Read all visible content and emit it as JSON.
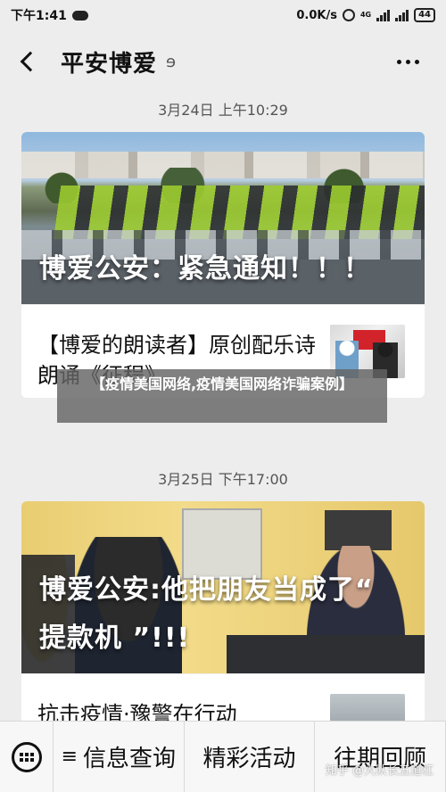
{
  "status_bar": {
    "time": "下午1:41",
    "network_speed": "0.0K/s",
    "signal_label": "4G",
    "battery": "44"
  },
  "header": {
    "title": "平安博爱"
  },
  "feed": [
    {
      "timestamp": "3月24日 上午10:29",
      "main_title": "博爱公安：紧急通知！！！",
      "sub_title": "【博爱的朗读者】原创配乐诗朗诵《征程》…"
    },
    {
      "timestamp": "3月25日 下午17:00",
      "main_title_line1": "博爱公安:他把朋友当成了“",
      "main_title_line2": "提款机 ”!!!",
      "sub_title": "抗击疫情·豫警在行动"
    }
  ],
  "popup": {
    "text": "【疫情美国网络,疫情美国网络诈骗案例】"
  },
  "bottom_menu": {
    "items": [
      "信息查询",
      "精彩活动",
      "往期回顾"
    ]
  },
  "watermark": "知乎 @大队长五道杠"
}
